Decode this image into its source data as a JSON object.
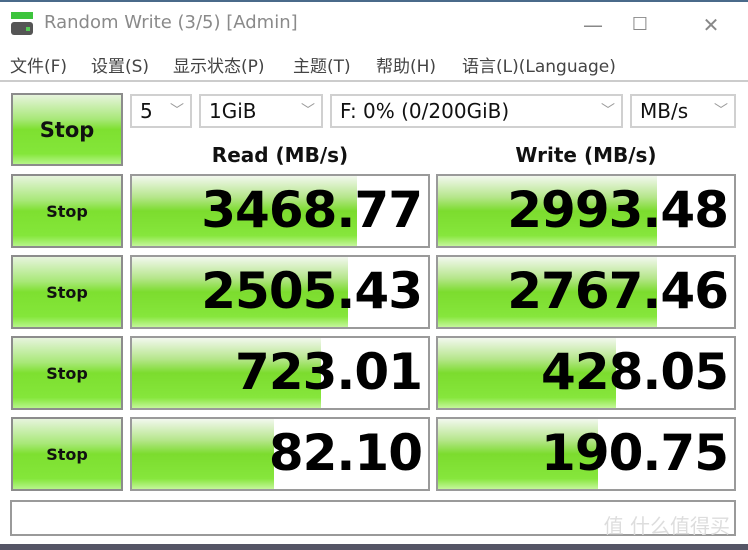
{
  "window": {
    "title": "Random Write (3/5) [Admin]",
    "icon": "disk-benchmark-icon",
    "controls": {
      "minimize": "—",
      "maximize": "☐",
      "close": "✕"
    }
  },
  "menu": [
    {
      "label": "文件(F)"
    },
    {
      "label": "设置(S)"
    },
    {
      "label": "显示状态(P)"
    },
    {
      "label": "主题(T)"
    },
    {
      "label": "帮助(H)"
    },
    {
      "label": "语言(L)(Language)"
    }
  ],
  "toolbar": {
    "all_button": "Stop",
    "count": "5",
    "size": "1GiB",
    "drive": "F: 0% (0/200GiB)",
    "unit": "MB/s"
  },
  "headers": {
    "read": "Read (MB/s)",
    "write": "Write (MB/s)"
  },
  "rows": [
    {
      "button": "Stop",
      "read": "3468.77",
      "write": "2993.48",
      "read_fill": 0.76,
      "write_fill": 0.74
    },
    {
      "button": "Stop",
      "read": "2505.43",
      "write": "2767.46",
      "read_fill": 0.73,
      "write_fill": 0.74
    },
    {
      "button": "Stop",
      "read": "723.01",
      "write": "428.05",
      "read_fill": 0.64,
      "write_fill": 0.6
    },
    {
      "button": "Stop",
      "read": "82.10",
      "write": "190.75",
      "read_fill": 0.48,
      "write_fill": 0.54
    }
  ],
  "status_text": "",
  "watermark": "值 什么值得买"
}
